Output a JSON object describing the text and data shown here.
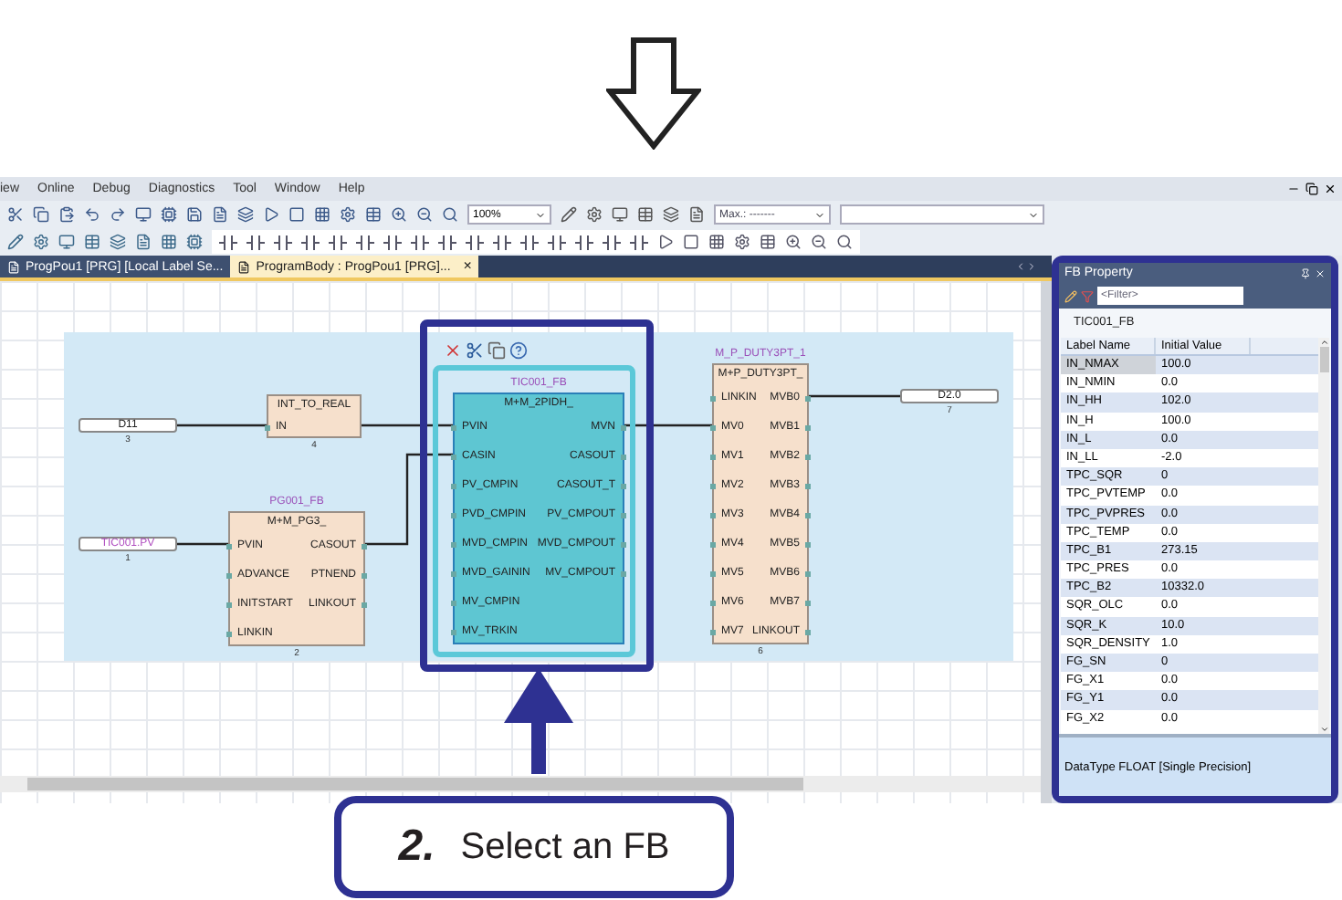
{
  "menu": [
    "iew",
    "Online",
    "Debug",
    "Diagnostics",
    "Tool",
    "Window",
    "Help"
  ],
  "toolbar": {
    "zoom": "100%",
    "monitor": "Max.: -------"
  },
  "tabs": [
    {
      "label": "ProgPou1 [PRG] [Local Label Se...",
      "selected": false
    },
    {
      "label": "ProgramBody : ProgPou1 [PRG]...",
      "selected": true,
      "close": "×"
    }
  ],
  "canvas": {
    "variables": [
      {
        "name": "D11",
        "number": "3",
        "kind": "device"
      },
      {
        "name": "TIC001.PV",
        "number": "1",
        "kind": "label"
      },
      {
        "name": "D2.0",
        "number": "7",
        "kind": "device"
      }
    ],
    "blocks": [
      {
        "kind": "function",
        "type": "INT_TO_REAL",
        "number": "4",
        "inputs": [
          "IN"
        ],
        "selected": false
      },
      {
        "kind": "fb",
        "instance": "PG001_FB",
        "type": "M+M_PG3_",
        "number": "2",
        "inputs": [
          "PVIN",
          "ADVANCE",
          "INITSTART",
          "LINKIN"
        ],
        "outputs": [
          "CASOUT",
          "PTNEND",
          "LINKOUT"
        ],
        "selected": false
      },
      {
        "kind": "fb",
        "instance": "TIC001_FB",
        "type": "M+M_2PIDH_",
        "inputs": [
          "PVIN",
          "CASIN",
          "PV_CMPIN",
          "PVD_CMPIN",
          "MVD_CMPIN",
          "MVD_GAININ",
          "MV_CMPIN",
          "MV_TRKIN"
        ],
        "outputs": [
          "MVN",
          "CASOUT",
          "CASOUT_T",
          "PV_CMPOUT",
          "MVD_CMPOUT",
          "MV_CMPOUT"
        ],
        "selected": true
      },
      {
        "kind": "fb",
        "instance": "M_P_DUTY3PT_1",
        "type": "M+P_DUTY3PT_",
        "number": "6",
        "inputs": [
          "LINKIN",
          "MV0",
          "MV1",
          "MV2",
          "MV3",
          "MV4",
          "MV5",
          "MV6",
          "MV7"
        ],
        "outputs": [
          "MVB0",
          "MVB1",
          "MVB2",
          "MVB3",
          "MVB4",
          "MVB5",
          "MVB6",
          "MVB7",
          "LINKOUT"
        ],
        "selected": false
      }
    ]
  },
  "fb_property": {
    "title": "FB Property",
    "filter_placeholder": "<Filter>",
    "instance": "TIC001_FB",
    "columns": [
      "Label Name",
      "Initial Value"
    ],
    "rows": [
      {
        "label": "IN_NMAX",
        "value": "100.0",
        "selected": true
      },
      {
        "label": "IN_NMIN",
        "value": "0.0",
        "selected": false
      },
      {
        "label": "IN_HH",
        "value": "102.0",
        "selected": false
      },
      {
        "label": "IN_H",
        "value": "100.0",
        "selected": false
      },
      {
        "label": "IN_L",
        "value": "0.0",
        "selected": false
      },
      {
        "label": "IN_LL",
        "value": "-2.0",
        "selected": false
      },
      {
        "label": "TPC_SQR",
        "value": "0",
        "selected": false
      },
      {
        "label": "TPC_PVTEMP",
        "value": "0.0",
        "selected": false
      },
      {
        "label": "TPC_PVPRES",
        "value": "0.0",
        "selected": false
      },
      {
        "label": "TPC_TEMP",
        "value": "0.0",
        "selected": false
      },
      {
        "label": "TPC_B1",
        "value": "273.15",
        "selected": false
      },
      {
        "label": "TPC_PRES",
        "value": "0.0",
        "selected": false
      },
      {
        "label": "TPC_B2",
        "value": "10332.0",
        "selected": false
      },
      {
        "label": "SQR_OLC",
        "value": "0.0",
        "selected": false
      },
      {
        "label": "SQR_K",
        "value": "10.0",
        "selected": false
      },
      {
        "label": "SQR_DENSITY",
        "value": "1.0",
        "selected": false
      },
      {
        "label": "FG_SN",
        "value": "0",
        "selected": false
      },
      {
        "label": "FG_X1",
        "value": "0.0",
        "selected": false
      },
      {
        "label": "FG_Y1",
        "value": "0.0",
        "selected": false
      },
      {
        "label": "FG_X2",
        "value": "0.0",
        "selected": false
      }
    ],
    "description": "DataType FLOAT [Single Precision]"
  },
  "callout": {
    "step": "2.",
    "text": "Select an FB"
  }
}
